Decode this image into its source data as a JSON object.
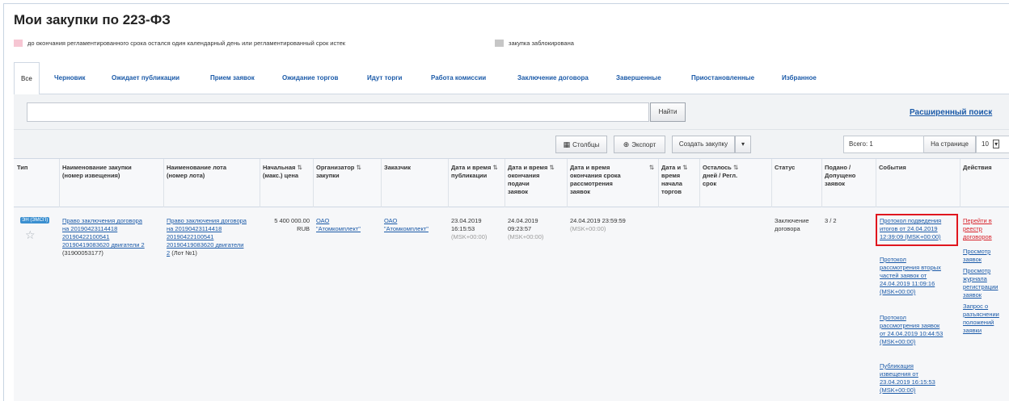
{
  "page_title": "Мои закупки по 223-ФЗ",
  "legend": {
    "overdue_text": "до окончания регламентированного срока остался один календарный день или регламентированный срок истек",
    "overdue_color": "#f6c6d3",
    "blocked_text": "закупка заблокирована",
    "blocked_color": "#c6c6c6"
  },
  "tabs": [
    {
      "label": "Все"
    },
    {
      "label": "Черновик"
    },
    {
      "label": "Ожидает публикации"
    },
    {
      "label": "Прием заявок"
    },
    {
      "label": "Ожидание торгов"
    },
    {
      "label": "Идут торги"
    },
    {
      "label": "Работа комиссии"
    },
    {
      "label": "Заключение договора"
    },
    {
      "label": "Завершенные"
    },
    {
      "label": "Приостановленные"
    },
    {
      "label": "Избранное"
    }
  ],
  "search": {
    "value": "",
    "button": "Найти",
    "advanced": "Расширенный поиск"
  },
  "toolbar": {
    "columns": "Столбцы",
    "export": "Экспорт",
    "create": "Создать закупку",
    "total": "Всего: 1",
    "per_page_label": "На странице",
    "per_page_value": "10"
  },
  "columns": {
    "type": "Тип",
    "name": [
      "Наименование закупки",
      "(номер извещения)"
    ],
    "lot": [
      "Наименование лота",
      "(номер лота)"
    ],
    "price": [
      "Начальная",
      "(макс.) цена"
    ],
    "organizer": [
      "Организатор",
      "закупки"
    ],
    "customer": "Заказчик",
    "published": [
      "Дата и время",
      "публикации"
    ],
    "deadline": [
      "Дата и время",
      "окончания",
      "подачи",
      "заявок"
    ],
    "review_end": [
      "Дата и время",
      "окончания срока",
      "рассмотрения",
      "заявок"
    ],
    "trade_start": [
      "Дата и",
      "время",
      "начала",
      "торгов"
    ],
    "days_left": [
      "Осталось",
      "дней / Регл.",
      "срок"
    ],
    "status": "Статус",
    "submitted": [
      "Подано /",
      "Допущено",
      "заявок"
    ],
    "events": "События",
    "actions": "Действия"
  },
  "row": {
    "type_badge": "ЭН (ЭМСП)",
    "name_link": [
      "Право заключения договора",
      "на 20190423114418",
      "20190422100541",
      "20190419083620 двигатели 2"
    ],
    "name_number": "(31900053177)",
    "lot_link": [
      "Право заключения договора",
      "на 20190423114418",
      "20190422100541",
      "20190419083620 двигатели",
      "2"
    ],
    "lot_number": "(Лот №1)",
    "price": "5 400 000.00",
    "currency": "RUB",
    "organizer": [
      "ОАО",
      "\"Атомкомплект\""
    ],
    "customer": [
      "ОАО",
      "\"Атомкомплект\""
    ],
    "published": [
      "23.04.2019",
      "16:15:53"
    ],
    "published_tz": "(МSK+00:00)",
    "deadline": [
      "24.04.2019",
      "09:23:57"
    ],
    "deadline_tz": "(МSK+00:00)",
    "review_end": "24.04.2019 23:59:59",
    "review_end_tz": "(МSK+00:00)",
    "status": [
      "Заключение",
      "договора"
    ],
    "submitted": "3 / 2",
    "events": [
      [
        "Протокол подведения",
        "итогов от 24.04.2019",
        "12:39:09 (МSK+00:00)"
      ],
      [
        "Протокол",
        "рассмотрения вторых",
        "частей заявок от",
        "24.04.2019 11:09:16",
        "(МSK+00:00)"
      ],
      [
        "Протокол",
        "рассмотрения заявок",
        "от 24.04.2019 10:44:53",
        "(МSK+00:00)"
      ],
      [
        "Публикация",
        "извещения от",
        "23.04.2019 16:15:53",
        "(МSK+00:00)"
      ]
    ],
    "actions_primary": [
      "Перейти в",
      "реестр",
      "договоров"
    ],
    "actions": [
      [
        "Просмотр",
        "заявок"
      ],
      [
        "Просмотр",
        "журнала",
        "регистрации",
        "заявок"
      ],
      [
        "Запрос о",
        "разъяснении",
        "положений",
        "заявки"
      ]
    ]
  }
}
